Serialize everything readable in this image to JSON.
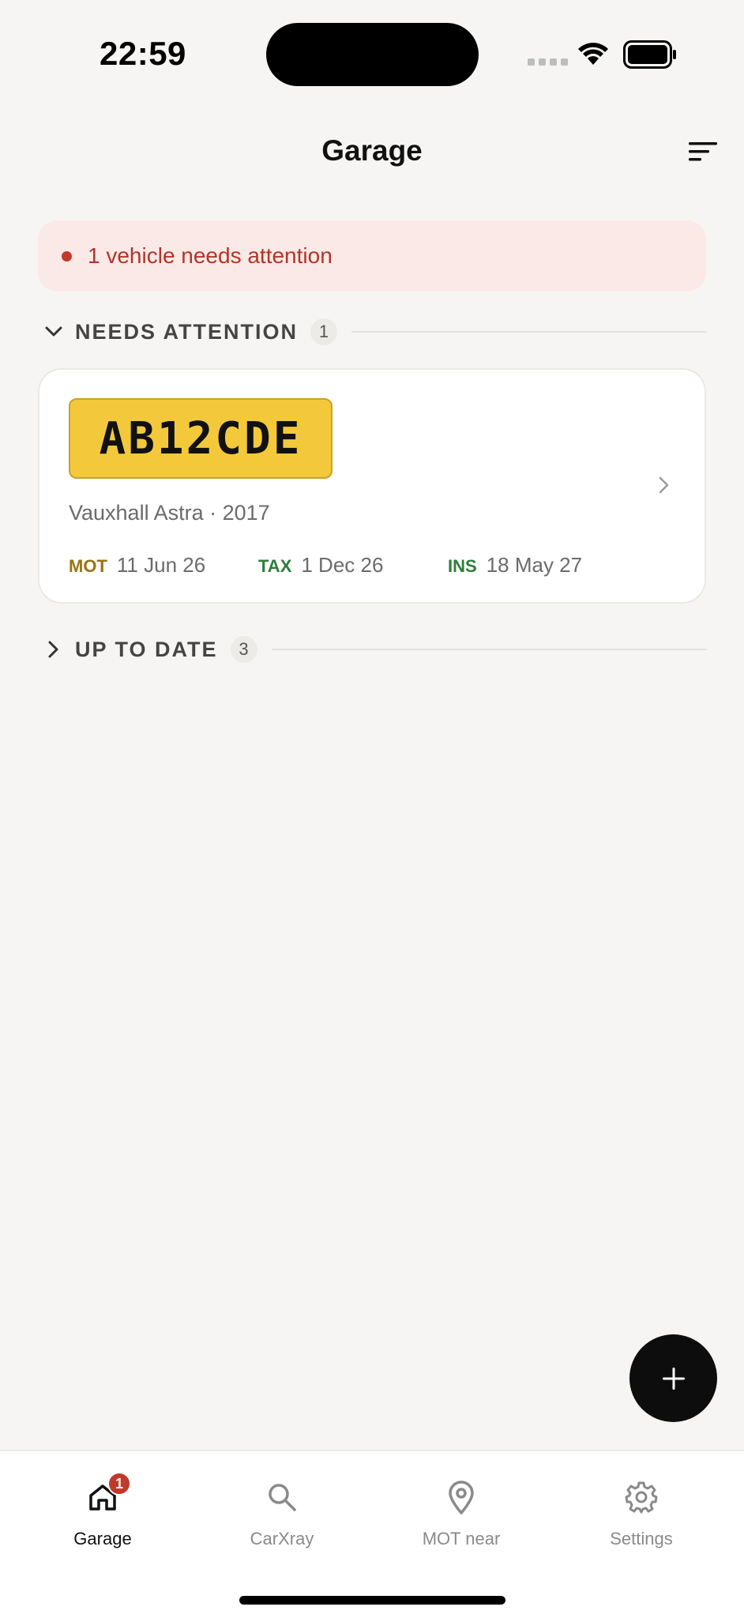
{
  "status_bar": {
    "time": "22:59"
  },
  "header": {
    "title": "Garage"
  },
  "alert": {
    "text": "1 vehicle needs attention"
  },
  "sections": {
    "needs_attention": {
      "title": "NEEDS ATTENTION",
      "count": "1",
      "expanded": true
    },
    "up_to_date": {
      "title": "UP TO DATE",
      "count": "3",
      "expanded": false
    }
  },
  "vehicle": {
    "plate": "AB12CDE",
    "model": "Vauxhall Astra · 2017",
    "dates": [
      {
        "tag": "MOT",
        "value": "11 Jun 26"
      },
      {
        "tag": "TAX",
        "value": "1 Dec 26"
      },
      {
        "tag": "INS",
        "value": "18 May 27"
      }
    ]
  },
  "nav": {
    "items": [
      {
        "label": "Garage",
        "icon": "home-icon",
        "active": true,
        "badge": "1"
      },
      {
        "label": "CarXray",
        "icon": "search-icon",
        "active": false
      },
      {
        "label": "MOT near",
        "icon": "location-pin-icon",
        "active": false
      },
      {
        "label": "Settings",
        "icon": "gear-icon",
        "active": false
      }
    ]
  },
  "colors": {
    "background": "#f6f5f3",
    "alert_bg": "#fbe9e7",
    "alert_text": "#b33428",
    "plate": "#f3c93b",
    "mot_tag": "#9a7410",
    "ok_tag": "#2e7d3a",
    "badge": "#c0392b"
  }
}
